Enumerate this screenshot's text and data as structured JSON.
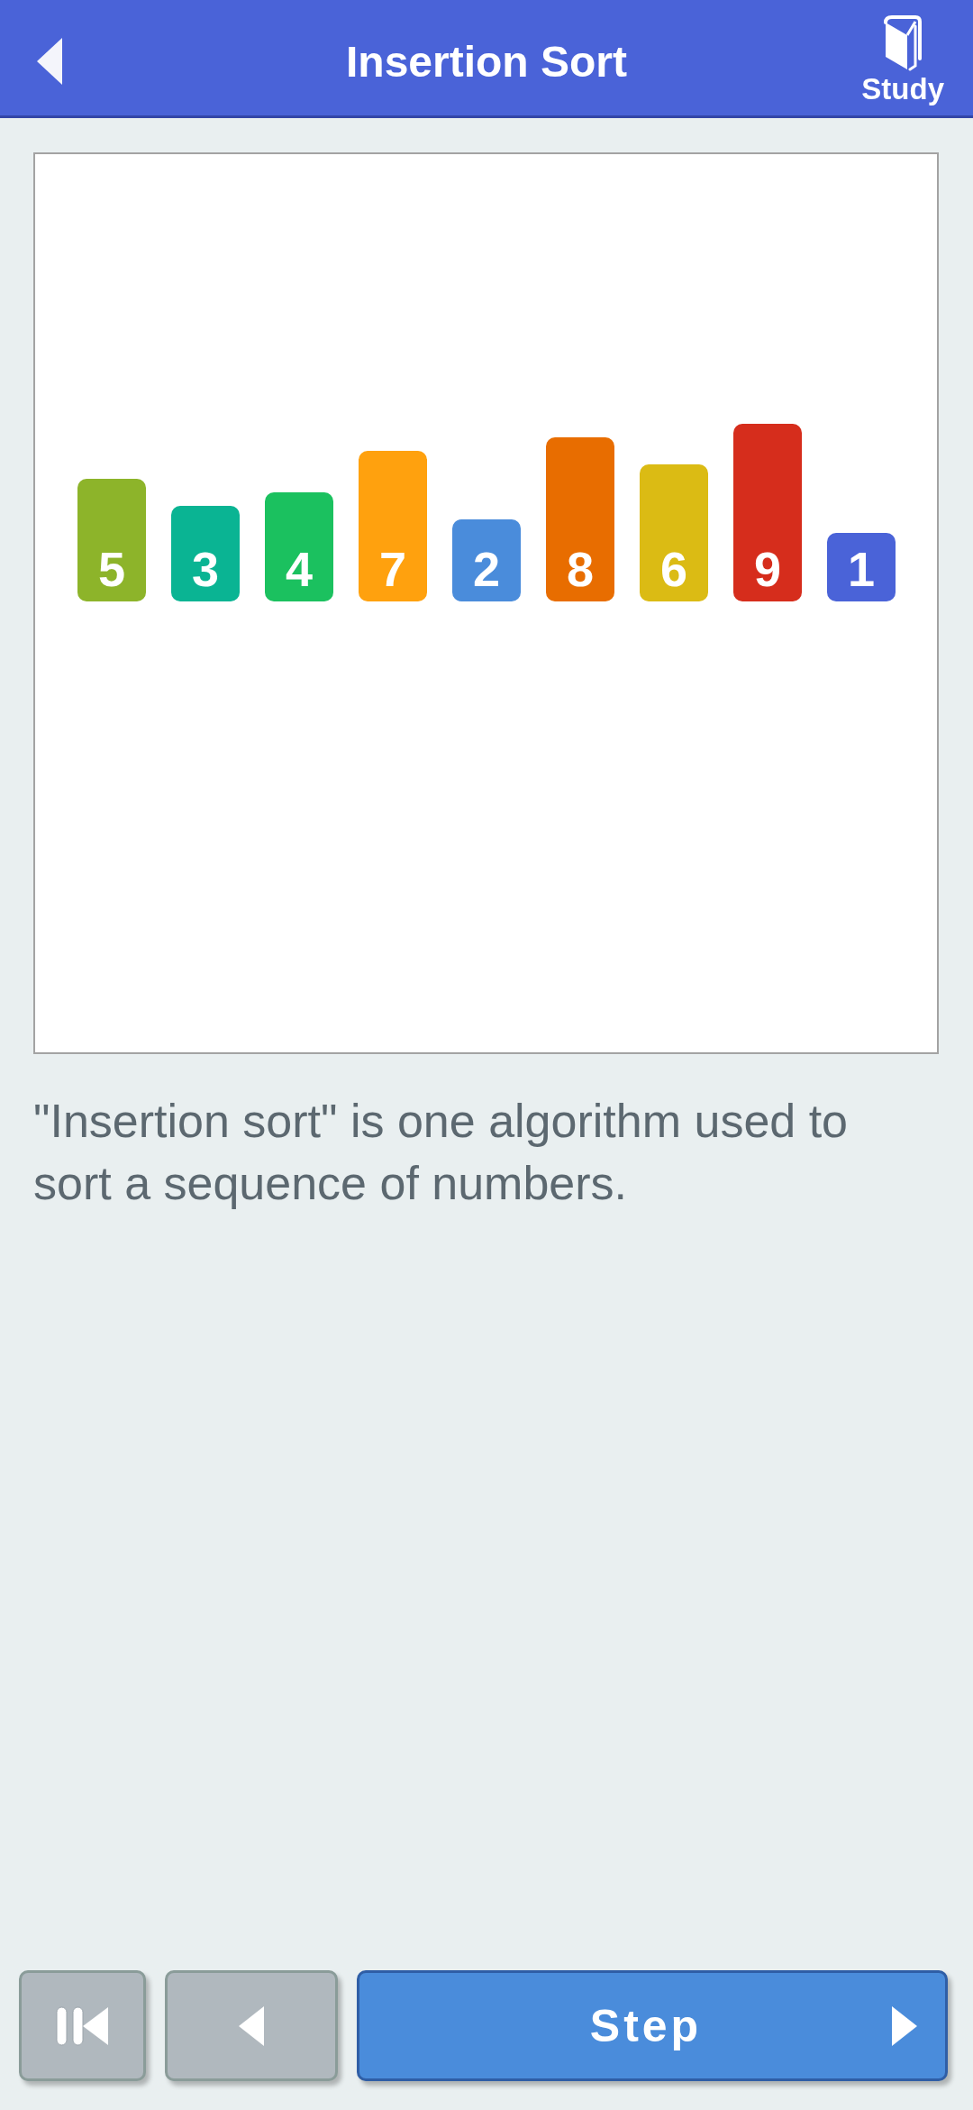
{
  "header": {
    "title": "Insertion Sort",
    "study_label": "Study"
  },
  "bars": [
    {
      "label": "5",
      "color": "#8db42a"
    },
    {
      "label": "3",
      "color": "#0ab493"
    },
    {
      "label": "4",
      "color": "#1bc15f"
    },
    {
      "label": "7",
      "color": "#ffa10e"
    },
    {
      "label": "2",
      "color": "#4a8cdb"
    },
    {
      "label": "8",
      "color": "#e86d00"
    },
    {
      "label": "6",
      "color": "#dbbb14"
    },
    {
      "label": "9",
      "color": "#d62d1c"
    },
    {
      "label": "1",
      "color": "#4a63d8"
    }
  ],
  "description": "\"Insertion sort\" is one algorithm used to sort a sequence of numbers.",
  "controls": [
    {
      "kind": "restart",
      "disabled": true
    },
    {
      "kind": "previous",
      "disabled": true
    },
    {
      "kind": "step",
      "label": "Step",
      "disabled": false
    }
  ]
}
